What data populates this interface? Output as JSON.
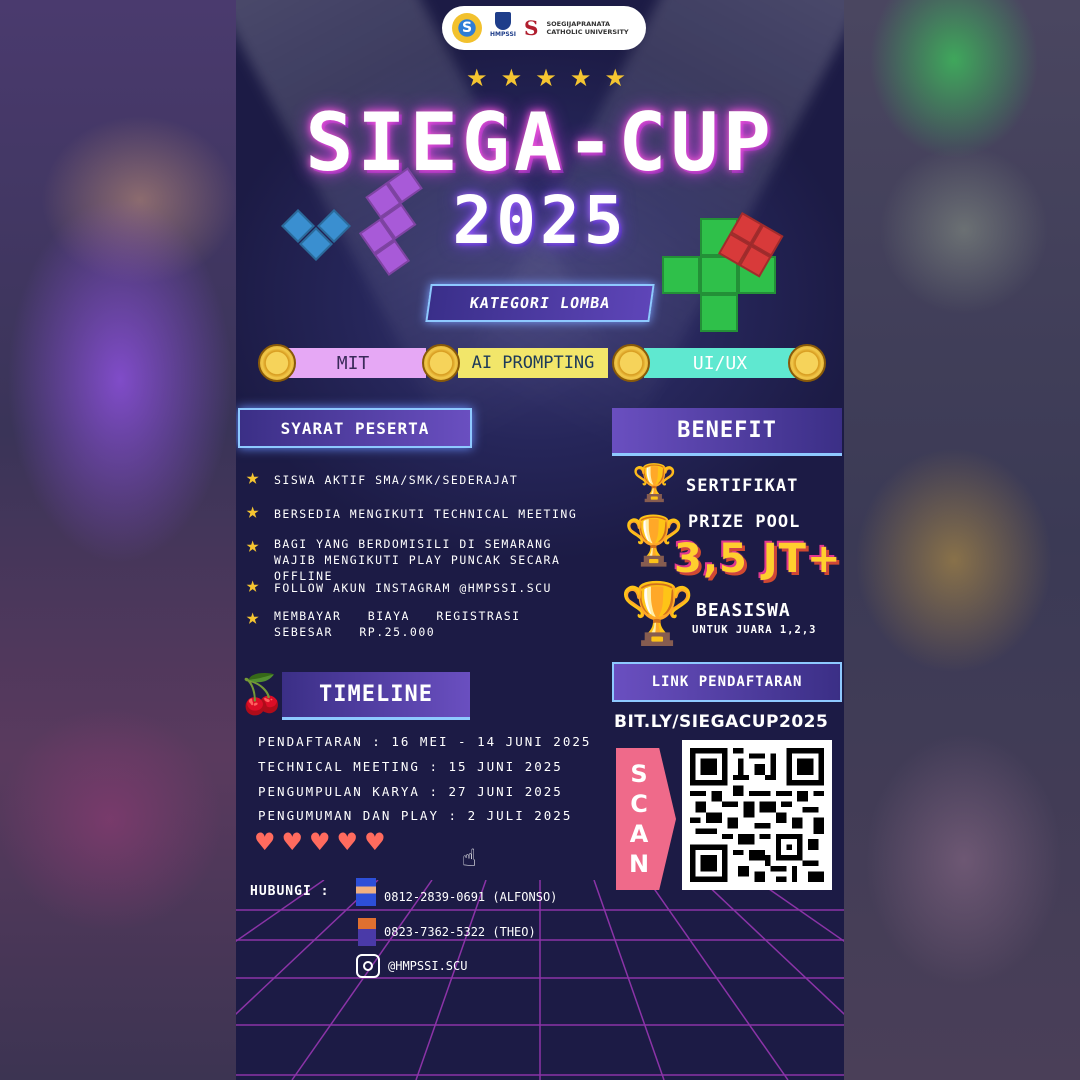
{
  "logos": {
    "univ_name_line1": "SOEGIJAPRANATA",
    "univ_name_line2": "CATHOLIC UNIVERSITY",
    "hmpssi": "HMPSSI",
    "univ_mark": "S"
  },
  "stars": [
    "★",
    "★",
    "★",
    "★",
    "★"
  ],
  "title": {
    "line1": "SIEGA-CUP",
    "line2": "2025"
  },
  "kategori": {
    "label": "KATEGORI LOMBA",
    "items": [
      "MIT",
      "AI PROMPTING",
      "UI/UX"
    ]
  },
  "syarat": {
    "label": "SYARAT PESERTA",
    "items": [
      "SISWA AKTIF SMA/SMK/SEDERAJAT",
      "BERSEDIA MENGIKUTI TECHNICAL MEETING",
      "BAGI YANG BERDOMISILI DI SEMARANG WAJIB MENGIKUTI PLAY PUNCAK SECARA OFFLINE",
      "FOLLOW AKUN INSTAGRAM @HMPSSI.SCU",
      "MEMBAYAR BIAYA REGISTRASI SEBESAR RP.25.000"
    ]
  },
  "benefit": {
    "label": "BENEFIT",
    "sertifikat": "SERTIFIKAT",
    "prize_pool": "PRIZE POOL",
    "prize_amount": "3,5 JT+",
    "beasiswa": "BEASISWA",
    "beasiswa_note": "UNTUK JUARA 1,2,3"
  },
  "timeline": {
    "label": "TIMELINE",
    "items": [
      "PENDAFTARAN : 16 MEI - 14 JUNI 2025",
      "TECHNICAL MEETING : 15 JUNI 2025",
      "PENGUMPULAN KARYA : 27 JUNI 2025",
      "PENGUMUMAN DAN PLAY : 2 JULI 2025"
    ]
  },
  "hearts": [
    "♥",
    "♥",
    "♥",
    "♥",
    "♥"
  ],
  "hubungi": {
    "label": "HUBUNGI :",
    "phone1": "0812-2839-0691 (ALFONSO)",
    "phone2": "0823-7362-5322 (THEO)",
    "instagram": "@HMPSSI.SCU"
  },
  "pendaftaran": {
    "label": "LINK PENDAFTARAN",
    "url": "BIT.LY/SIEGACUP2025",
    "scan": [
      "S",
      "C",
      "A",
      "N"
    ]
  },
  "colors": {
    "accent_pink": "#ff5ed8",
    "gold": "#f5c531",
    "pill_pink": "#e6a8f5",
    "pill_yellow": "#f2e66a",
    "pill_teal": "#5fe8d0"
  }
}
